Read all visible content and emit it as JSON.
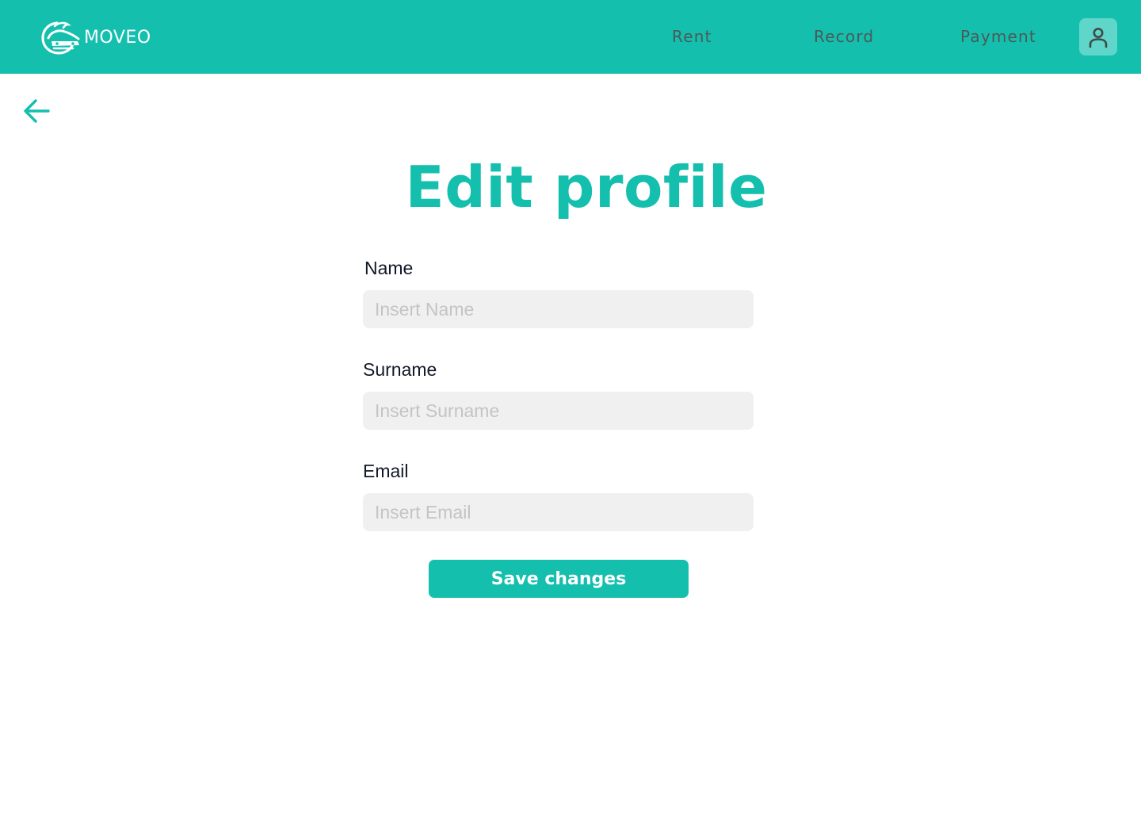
{
  "header": {
    "brand_name": "MOVEO",
    "nav": {
      "rent": "Rent",
      "record": "Record",
      "payment": "Payment"
    },
    "avatar_icon": "user-icon"
  },
  "main": {
    "back_icon": "arrow-left-icon",
    "title": "Edit profile",
    "form": {
      "name": {
        "label": "Name",
        "placeholder": "Insert Name",
        "value": ""
      },
      "surname": {
        "label": "Surname",
        "placeholder": "Insert Surname",
        "value": ""
      },
      "email": {
        "label": "Email",
        "placeholder": "Insert Email",
        "value": ""
      },
      "submit_label": "Save changes"
    }
  },
  "colors": {
    "accent": "#14bfae",
    "avatar_bg": "#5fd6c9",
    "nav_text": "#4b5a58",
    "input_bg": "#f0f0f0",
    "placeholder": "#c4c4c4",
    "label_text": "#111827"
  }
}
